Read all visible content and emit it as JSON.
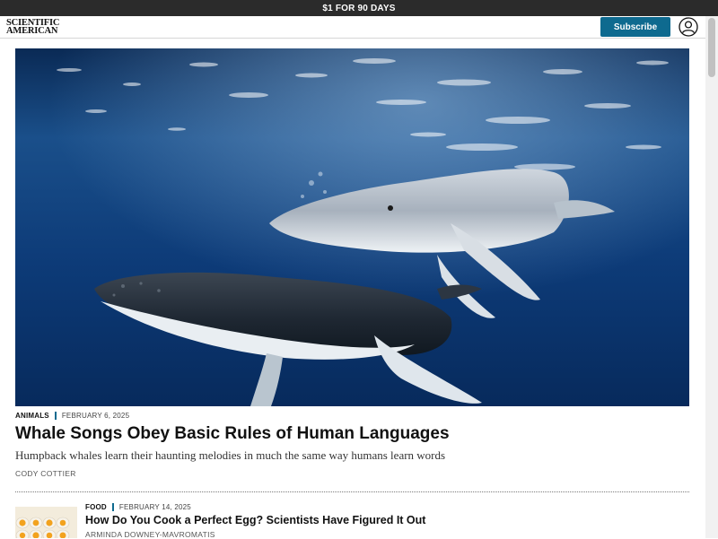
{
  "promo": {
    "text": "$1 FOR 90 DAYS"
  },
  "header": {
    "logo_line1": "SCIENTIFIC",
    "logo_line2": "AMERICAN",
    "subscribe_label": "Subscribe",
    "account_icon": "user-circle-icon"
  },
  "featured": {
    "image_icon": "humpback-whales-photo",
    "category": "ANIMALS",
    "date": "FEBRUARY 6, 2025",
    "title": "Whale Songs Obey Basic Rules of Human Languages",
    "dek": "Humpback whales learn their haunting melodies in much the same way humans learn words",
    "author": "CODY COTTIER"
  },
  "articles": [
    {
      "category": "FOOD",
      "date": "FEBRUARY 14, 2025",
      "title": "How Do You Cook a Perfect Egg? Scientists Have Figured It Out",
      "author": "ARMINDA DOWNEY-MAVROMATIS",
      "image_icon": "eggs-photo"
    }
  ],
  "colors": {
    "accent": "#0e6a8f",
    "promo_bg": "#2b2b2b",
    "ocean": "#0b3a6e"
  }
}
